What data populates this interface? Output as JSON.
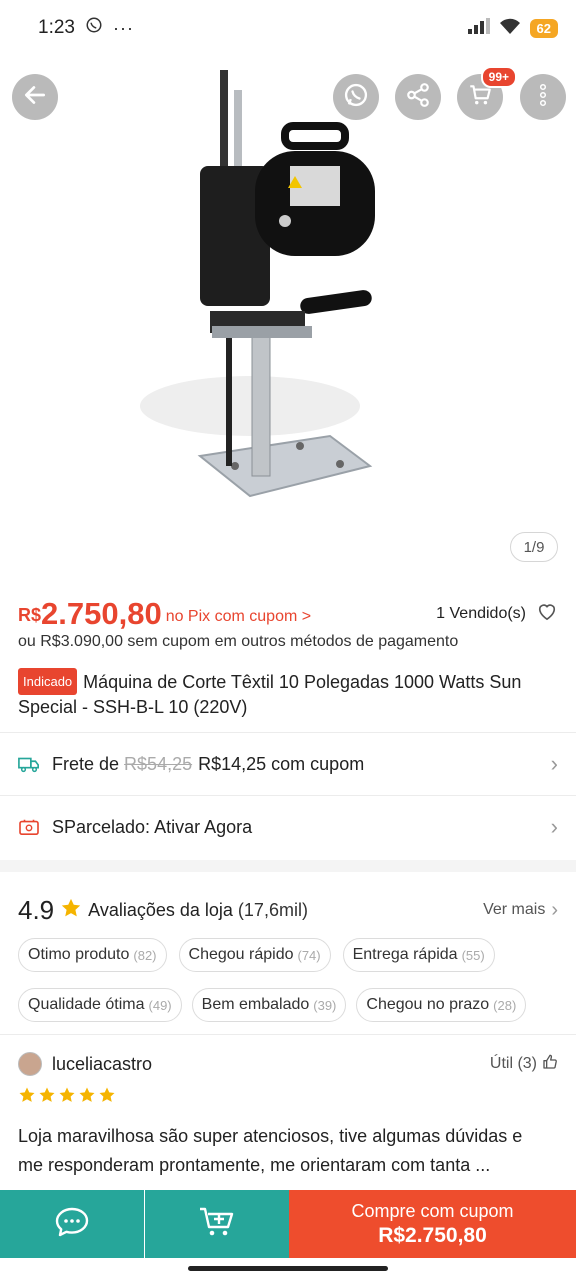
{
  "status_bar": {
    "time": "1:23",
    "battery": "62"
  },
  "product": {
    "image_counter": "1/9",
    "cart_badge": "99+",
    "price_currency": "R$",
    "price_value": "2.750,80",
    "price_note": "no Pix com cupom >",
    "sold": "1 Vendido(s)",
    "alt_price": "ou R$3.090,00 sem cupom em outros métodos de pagamento",
    "tag": "Indicado",
    "title": "Máquina de Corte Têxtil 10 Polegadas 1000 Watts Sun Special - SSH-B-L 10 (220V)"
  },
  "shipping": {
    "label": "Frete de",
    "old_price": "R$54,25",
    "new_price": "R$14,25 com cupom"
  },
  "installment": {
    "label": "SParcelado: Ativar Agora"
  },
  "store_rating": {
    "score": "4.9",
    "label": "Avaliações da loja",
    "count": "(17,6mil)",
    "see_more": "Ver mais",
    "tags_row1": [
      {
        "label": "Otimo produto",
        "count": "(82)"
      },
      {
        "label": "Chegou rápido",
        "count": "(74)"
      },
      {
        "label": "Entrega rápida",
        "count": "(55)"
      }
    ],
    "tags_row2": [
      {
        "label": "Qualidade ótima",
        "count": "(49)"
      },
      {
        "label": "Bem embalado",
        "count": "(39)"
      },
      {
        "label": "Chegou no prazo",
        "count": "(28)"
      }
    ]
  },
  "review": {
    "username": "luceliacastro",
    "helpful": "Útil (3)",
    "stars": 5,
    "text": "Loja maravilhosa são super atenciosos, tive algumas dúvidas e me responderam prontamente, me orientaram com tanta ..."
  },
  "bottom_bar": {
    "buy_line1": "Compre com cupom",
    "buy_line2": "R$2.750,80"
  },
  "colors": {
    "accent": "#ee4d2d",
    "price": "#e8452f",
    "teal": "#26a69a",
    "star": "#f5b400"
  }
}
